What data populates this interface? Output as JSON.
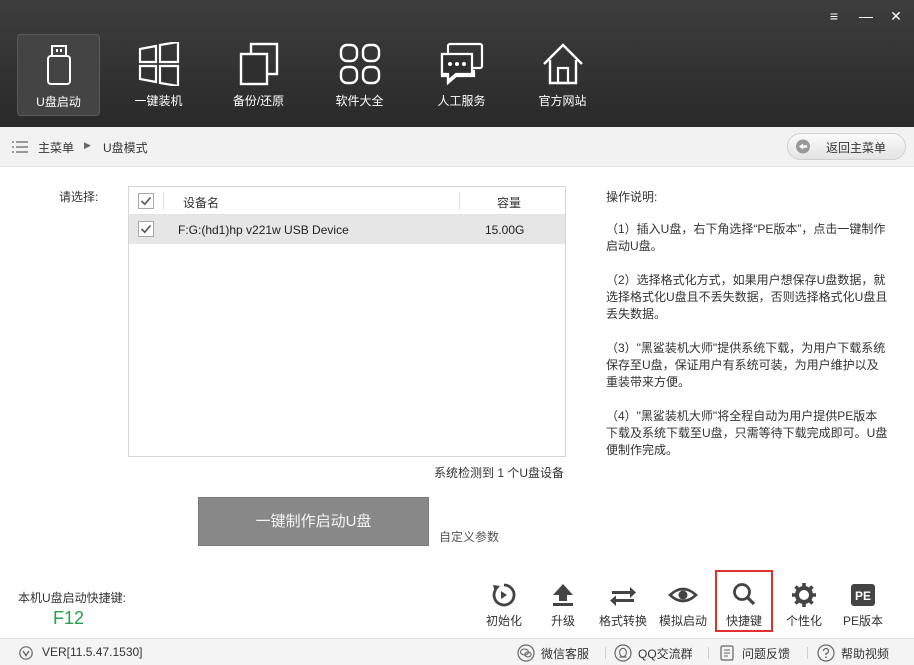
{
  "window": {
    "menu_icon": "≡",
    "min_icon": "—",
    "close_icon": "✕"
  },
  "nav": {
    "items": [
      {
        "label": "U盘启动",
        "icon": "usb-icon",
        "active": true
      },
      {
        "label": "一键装机",
        "icon": "windows-icon"
      },
      {
        "label": "备份/还原",
        "icon": "backup-icon"
      },
      {
        "label": "软件大全",
        "icon": "apps-grid-icon"
      },
      {
        "label": "人工服务",
        "icon": "chat-icon"
      },
      {
        "label": "官方网站",
        "icon": "home-icon"
      }
    ]
  },
  "breadcrumb": {
    "home": "主菜单",
    "separator": "▶",
    "current": "U盘模式"
  },
  "back_button": {
    "label": "返回主菜单"
  },
  "main": {
    "select_label": "请选择:",
    "table": {
      "headers": {
        "name": "设备名",
        "capacity": "容量"
      },
      "rows": [
        {
          "checked": true,
          "name": "F:G:(hd1)hp v221w USB Device",
          "capacity": "15.00G"
        }
      ]
    },
    "detect_text": "系统检测到 1 个U盘设备",
    "make_button": "一键制作启动U盘",
    "custom_params": "自定义参数"
  },
  "instructions": {
    "title": "操作说明:",
    "p1": "（1）插入U盘，右下角选择“PE版本”，点击一键制作启动U盘。",
    "p2": "（2）选择格式化方式，如果用户想保存U盘数据，就选择格式化U盘且不丢失数据，否则选择格式化U盘且丢失数据。",
    "p3": "（3）\"黑鲨装机大师\"提供系统下载，为用户下载系统保存至U盘，保证用户有系统可装，为用户维护以及重装带来方便。",
    "p4": "（4）\"黑鲨装机大师\"将全程自动为用户提供PE版本下载及系统下载至U盘，只需等待下载完成即可。U盘便制作完成。"
  },
  "hotkey": {
    "label": "本机U盘启动快捷键:",
    "value": "F12"
  },
  "tools": [
    {
      "label": "初始化",
      "icon": "reset-icon"
    },
    {
      "label": "升级",
      "icon": "upload-arrow-icon"
    },
    {
      "label": "格式转换",
      "icon": "convert-icon"
    },
    {
      "label": "模拟启动",
      "icon": "eye-icon"
    },
    {
      "label": "快捷键",
      "icon": "search-icon",
      "highlighted": true
    },
    {
      "label": "个性化",
      "icon": "gear-icon"
    },
    {
      "label": "PE版本",
      "icon": "pe-icon",
      "icon_text": "PE"
    }
  ],
  "status": {
    "version": "VER[11.5.47.1530]",
    "items": [
      {
        "label": "微信客服",
        "icon": "wechat-icon"
      },
      {
        "label": "QQ交流群",
        "icon": "qq-icon"
      },
      {
        "label": "问题反馈",
        "icon": "feedback-icon"
      },
      {
        "label": "帮助视频",
        "icon": "help-icon"
      }
    ]
  },
  "colors": {
    "topbar": "#333333",
    "hotkey_green": "#2aa14a",
    "highlight_red": "#e03030",
    "make_button": "#888888"
  }
}
